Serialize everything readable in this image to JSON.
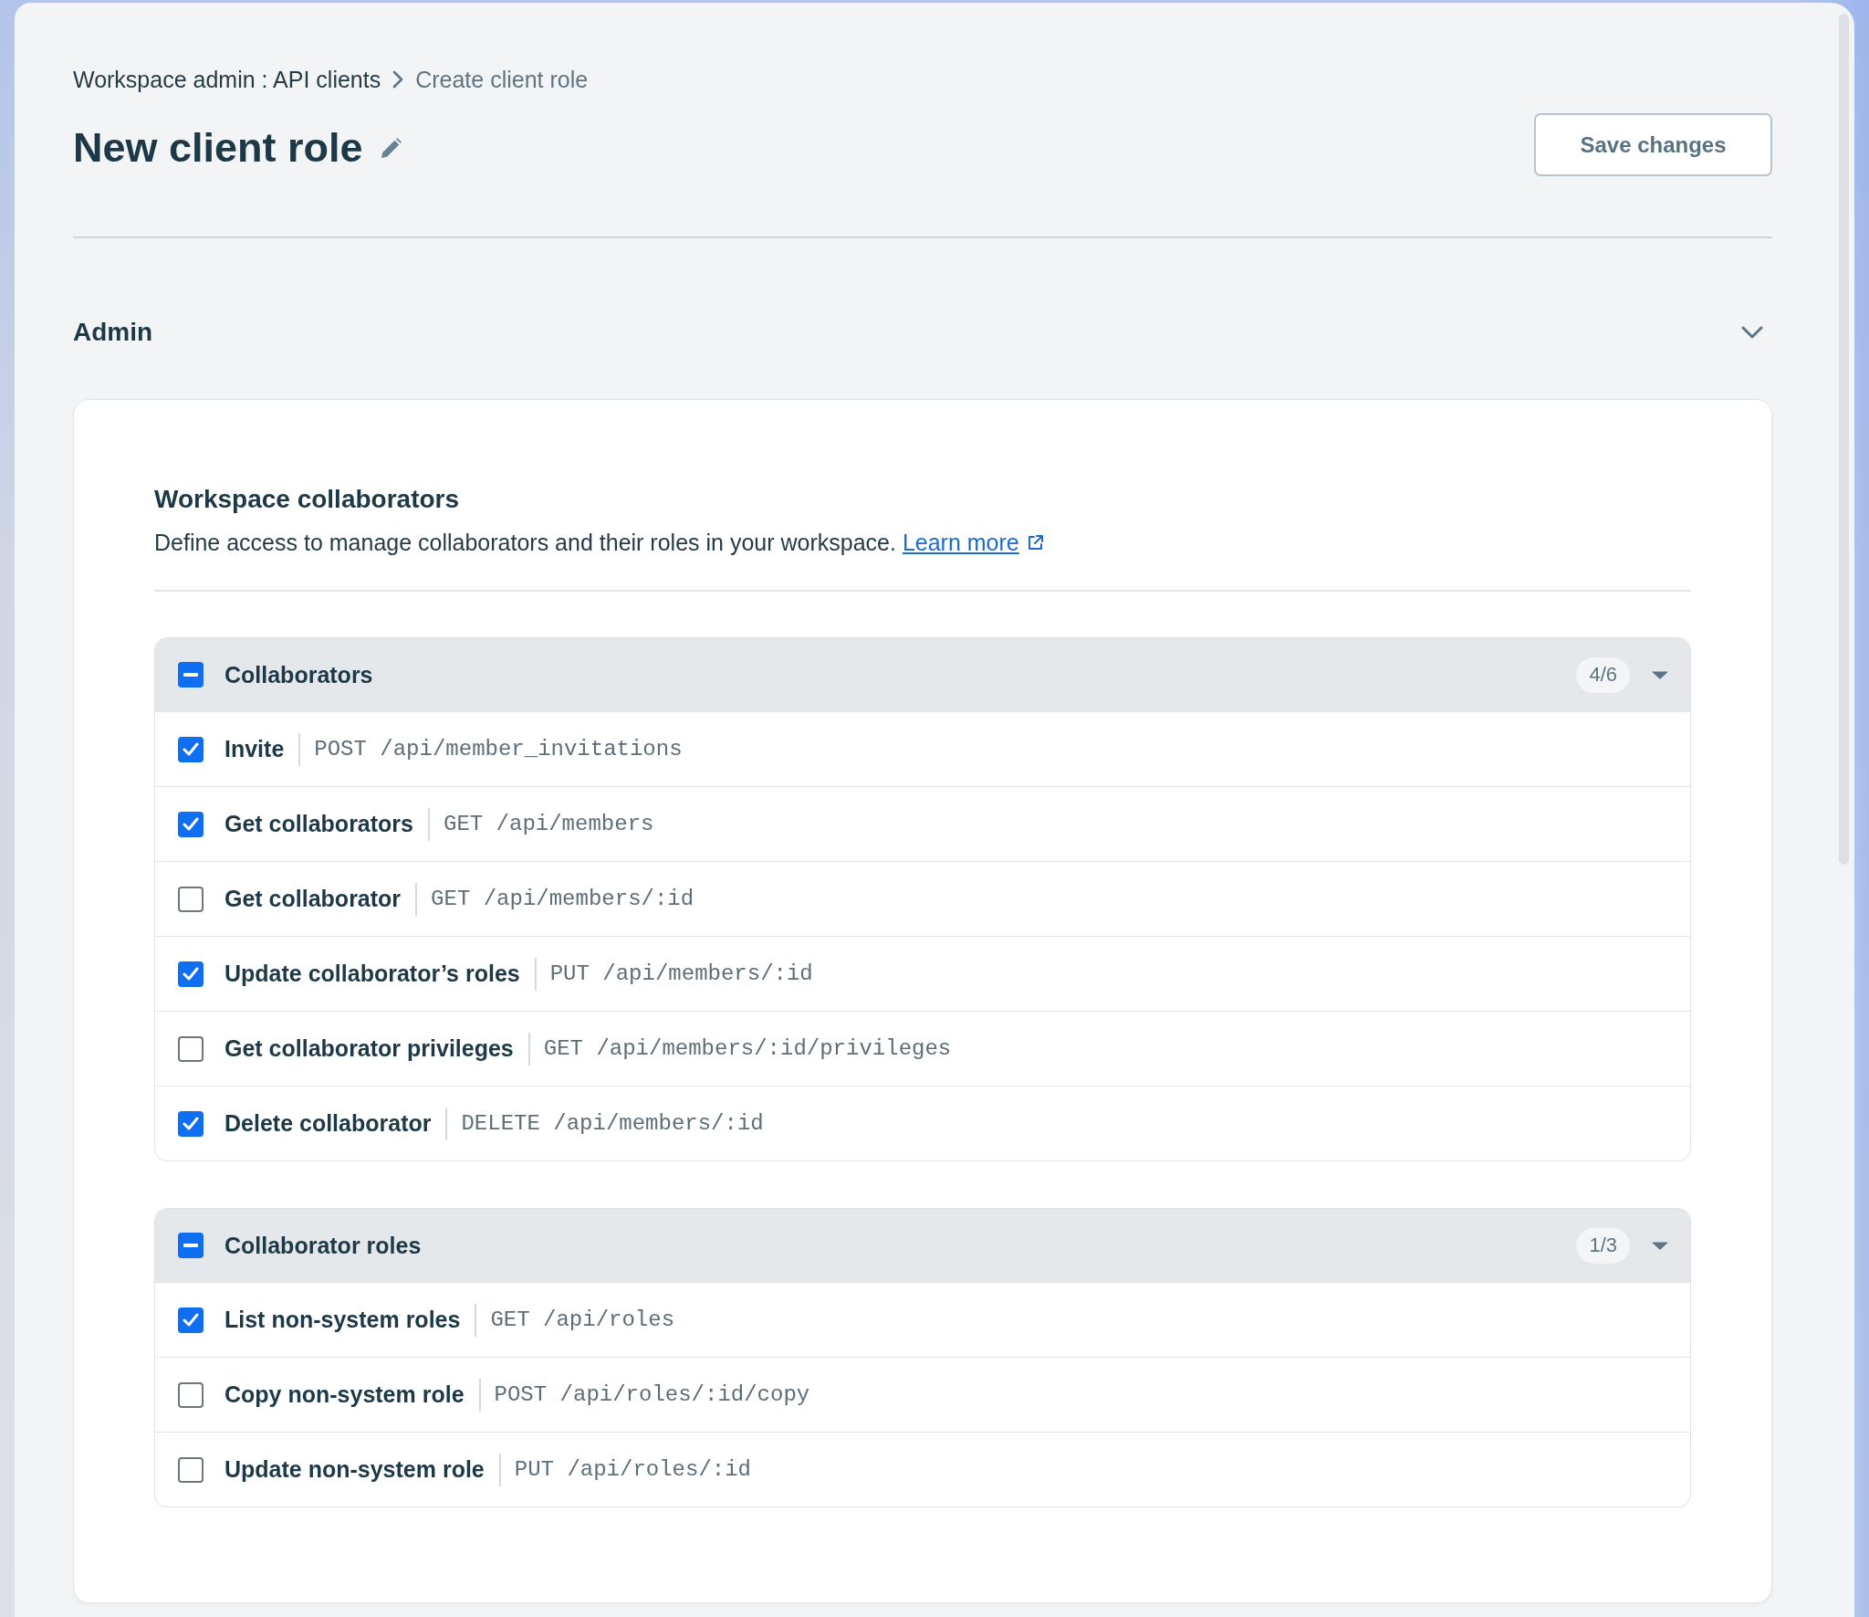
{
  "breadcrumb": [
    {
      "label": "Workspace admin : API clients",
      "current": false
    },
    {
      "label": "Create client role",
      "current": true
    }
  ],
  "title": "New client role",
  "save_button": {
    "label": "Save changes"
  },
  "section": {
    "title": "Admin",
    "expanded": true,
    "card": {
      "title": "Workspace collaborators",
      "description": "Define access to manage collaborators and their roles in your workspace.",
      "link": "Learn more",
      "groups": [
        {
          "name": "Collaborators",
          "partial": true,
          "count": "4/6",
          "expanded": true,
          "permissions": [
            {
              "name": "Invite",
              "endpoint": "POST /api/member_invitations",
              "checked": true
            },
            {
              "name": "Get collaborators",
              "endpoint": "GET /api/members",
              "checked": true
            },
            {
              "name": "Get collaborator",
              "endpoint": "GET /api/members/:id",
              "checked": false
            },
            {
              "name": "Update collaborator’s roles",
              "endpoint": "PUT /api/members/:id",
              "checked": true
            },
            {
              "name": "Get collaborator privileges",
              "endpoint": "GET /api/members/:id/privileges",
              "checked": false
            },
            {
              "name": "Delete collaborator",
              "endpoint": "DELETE /api/members/:id",
              "checked": true
            }
          ]
        },
        {
          "name": "Collaborator roles",
          "partial": true,
          "count": "1/3",
          "expanded": true,
          "permissions": [
            {
              "name": "List non-system roles",
              "endpoint": "GET /api/roles",
              "checked": true
            },
            {
              "name": "Copy non-system role",
              "endpoint": "POST /api/roles/:id/copy",
              "checked": false
            },
            {
              "name": "Update non-system role",
              "endpoint": "PUT /api/roles/:id",
              "checked": false
            }
          ]
        }
      ]
    }
  }
}
